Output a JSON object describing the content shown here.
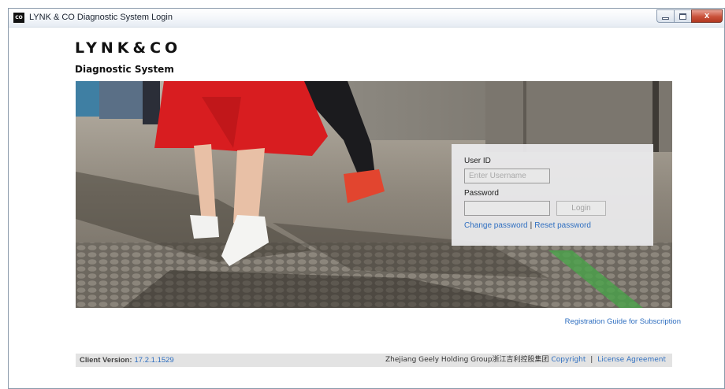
{
  "window": {
    "icon_text": "CO",
    "title": "LYNK & CO Diagnostic System Login",
    "close_glyph": "x"
  },
  "brand": {
    "logo": "LYNK&CO",
    "subtitle": "Diagnostic System"
  },
  "login": {
    "user_id_label": "User ID",
    "username_placeholder": "Enter Username",
    "username_value": "",
    "password_label": "Password",
    "password_value": "",
    "login_button": "Login",
    "change_password": "Change password",
    "separator": "|",
    "reset_password": "Reset password"
  },
  "registration_guide": "Registration Guide for Subscription",
  "footer": {
    "client_version_label": "Client Version:",
    "client_version": "17.2.1.1529",
    "company": "Zhejiang Geely Holding Group浙江吉利控股集团",
    "copyright": "Copyright",
    "separator": "|",
    "license": "License Agreement"
  },
  "colors": {
    "link": "#2f6fc0",
    "footer_bg": "#e3e3e3",
    "skirt_red": "#d81d20",
    "sneaker_red": "#e2452f"
  }
}
